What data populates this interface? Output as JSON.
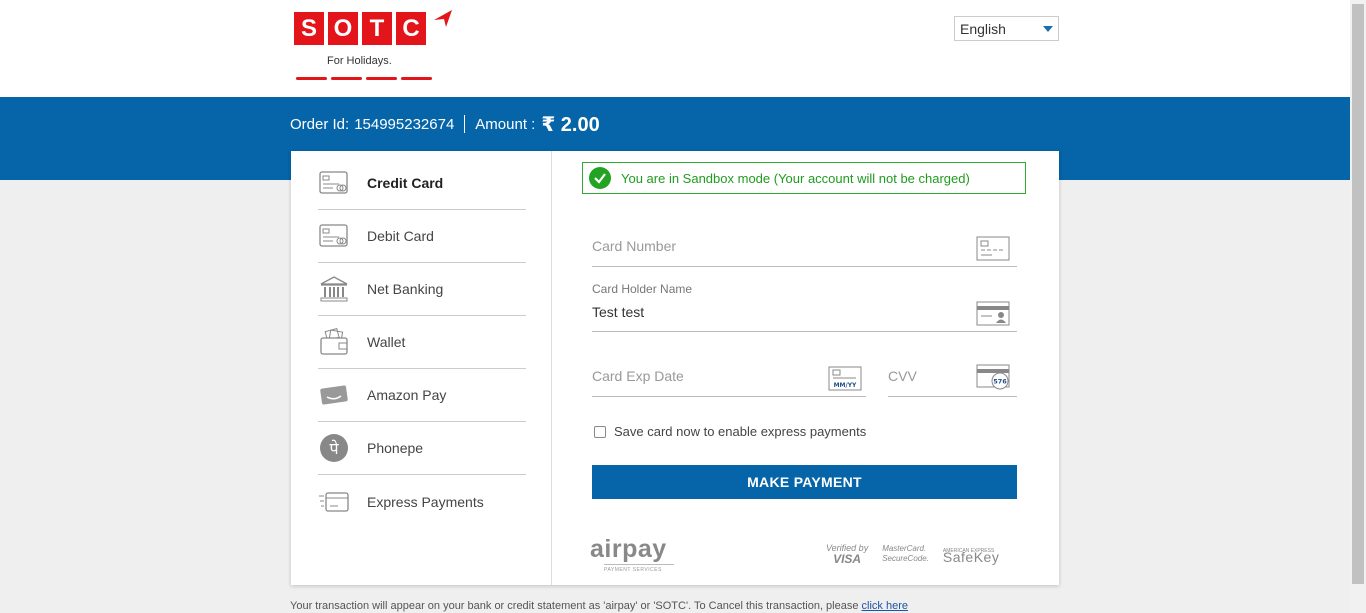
{
  "brand": {
    "letters": [
      "S",
      "O",
      "T",
      "C"
    ],
    "tagline": "For Holidays."
  },
  "language": {
    "selected": "English"
  },
  "order": {
    "id_label": "Order Id:",
    "id_value": "154995232674",
    "amount_label": "Amount :",
    "amount_value": "₹ 2.00"
  },
  "payment_methods": [
    {
      "label": "Credit Card",
      "icon": "credit-card-icon",
      "active": true
    },
    {
      "label": "Debit Card",
      "icon": "debit-card-icon",
      "active": false
    },
    {
      "label": "Net Banking",
      "icon": "bank-icon",
      "active": false
    },
    {
      "label": "Wallet",
      "icon": "wallet-icon",
      "active": false
    },
    {
      "label": "Amazon Pay",
      "icon": "amazon-pay-icon",
      "active": false
    },
    {
      "label": "Phonepe",
      "icon": "phonepe-icon",
      "active": false
    },
    {
      "label": "Express Payments",
      "icon": "express-card-icon",
      "active": false
    }
  ],
  "sandbox_notice": "You are in Sandbox mode (Your account will not be charged)",
  "form": {
    "card_number_placeholder": "Card Number",
    "card_holder_label": "Card Holder Name",
    "card_holder_value": "Test test",
    "exp_placeholder": "Card Exp Date",
    "exp_icon_text": "MM/YY",
    "cvv_placeholder": "CVV",
    "cvv_icon_text": "576",
    "save_card_label": "Save card now to enable express payments",
    "submit_label": "MAKE PAYMENT"
  },
  "partners": {
    "airpay": "airpay",
    "airpay_sub": "PAYMENT SERVICES",
    "verified_by": "Verified by",
    "visa": "VISA",
    "mastercard_1": "MasterCard.",
    "mastercard_2": "SecureCode.",
    "amex": "AMERICAN EXPRESS",
    "safekey": "SafeKey"
  },
  "footer": {
    "text": "Your transaction will appear on your bank or credit statement as 'airpay' or 'SOTC'. To Cancel this transaction, please ",
    "link": "click here"
  },
  "colors": {
    "brand_red": "#e4141b",
    "primary_blue": "#0565a8",
    "success_green": "#22a322"
  }
}
